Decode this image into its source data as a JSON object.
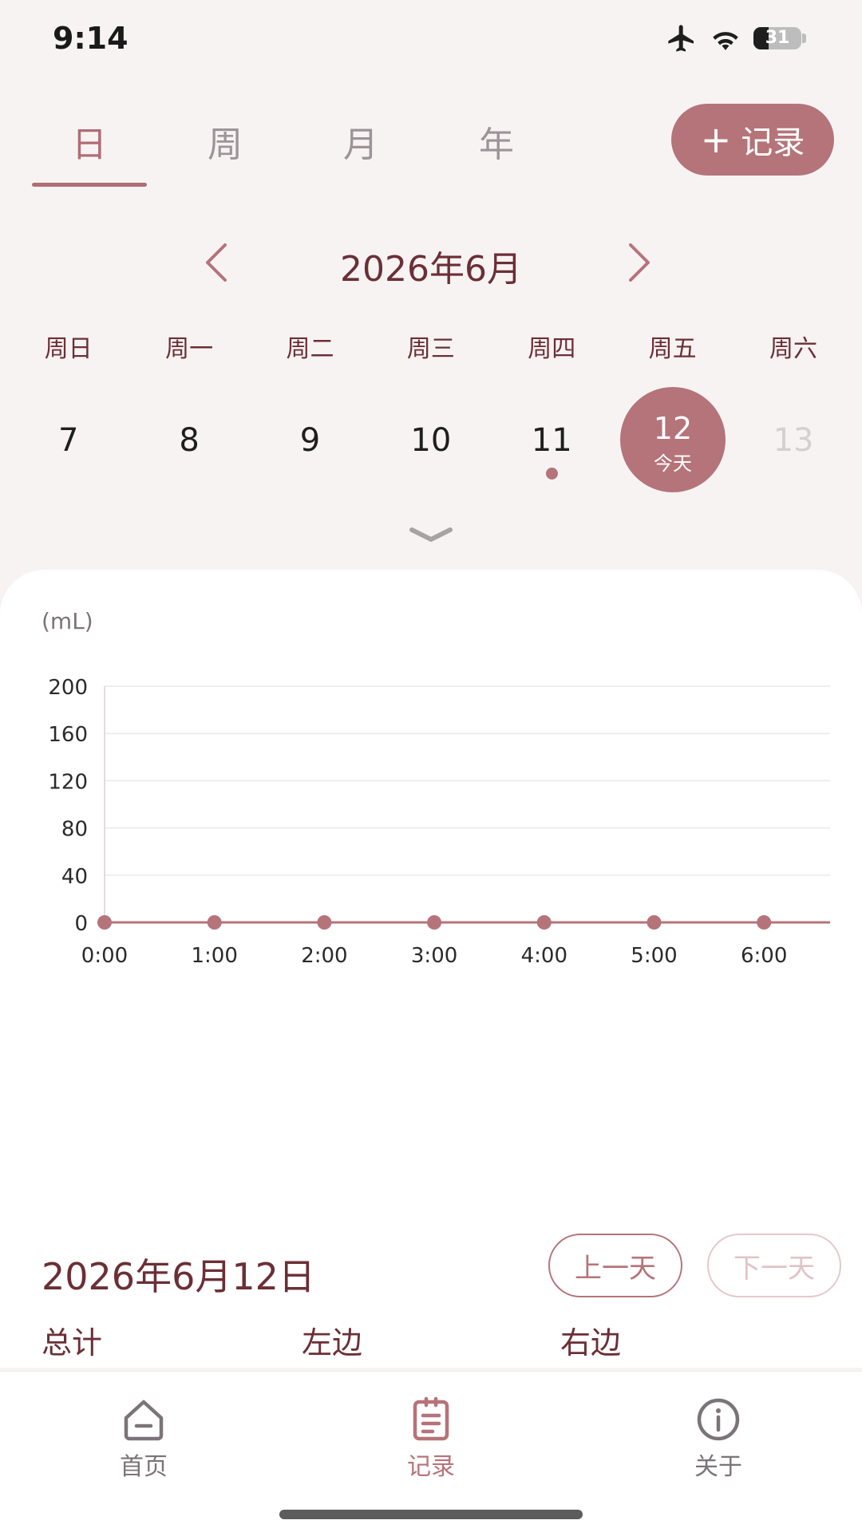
{
  "status_bar": {
    "time": "9:14",
    "battery": "31",
    "battery_level": 0.31
  },
  "tabs": [
    {
      "label": "日",
      "active": true
    },
    {
      "label": "周",
      "active": false
    },
    {
      "label": "月",
      "active": false
    },
    {
      "label": "年",
      "active": false
    }
  ],
  "add_button": {
    "plus": "+",
    "label": "记录"
  },
  "month_nav": {
    "title": "2026年6月"
  },
  "weekdays": [
    "周日",
    "周一",
    "周二",
    "周三",
    "周四",
    "周五",
    "周六"
  ],
  "dates": [
    {
      "num": "7"
    },
    {
      "num": "8"
    },
    {
      "num": "9"
    },
    {
      "num": "10"
    },
    {
      "num": "11",
      "has_record": true
    },
    {
      "num": "12",
      "today_label": "今天"
    },
    {
      "num": "13"
    }
  ],
  "chart_data": {
    "type": "line",
    "ylabel": "(mL)",
    "ylim": [
      0,
      200
    ],
    "yticks": [
      "200",
      "160",
      "120",
      "80",
      "40",
      "0"
    ],
    "categories": [
      "0:00",
      "1:00",
      "2:00",
      "3:00",
      "4:00",
      "5:00",
      "6:00"
    ],
    "values": [
      0,
      0,
      0,
      0,
      0,
      0,
      0
    ],
    "grid": true,
    "colors": {
      "line": "#b57479",
      "grid": "#eeeeee",
      "axis": "#e4dcdd"
    }
  },
  "detail": {
    "date_title": "2026年6月12日",
    "prev_day": "上一天",
    "next_day": "下一天",
    "total_label": "总计",
    "left_label": "左边",
    "right_label": "右边"
  },
  "bottom_nav": [
    {
      "label": "首页",
      "icon": "home-icon",
      "active": false
    },
    {
      "label": "记录",
      "icon": "clipboard-icon",
      "active": true
    },
    {
      "label": "关于",
      "icon": "info-icon",
      "active": false
    }
  ],
  "colors": {
    "accent": "#b57479",
    "title_text": "#6b2f35",
    "background": "#f8f3f3"
  }
}
